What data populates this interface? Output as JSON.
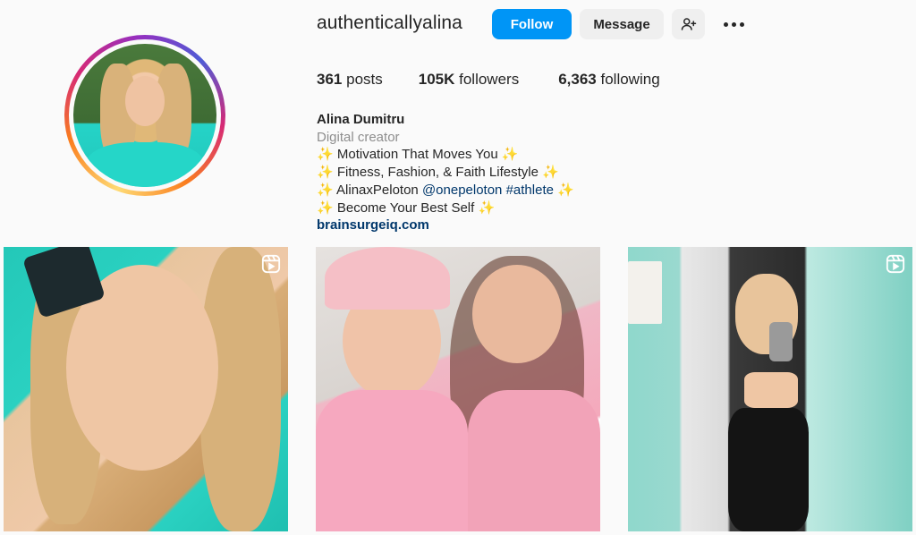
{
  "profile": {
    "username": "authenticallyalina",
    "follow_label": "Follow",
    "message_label": "Message",
    "add_user_icon": "person-add-icon",
    "more_icon": "more-options-icon"
  },
  "stats": {
    "posts_count": "361",
    "posts_label": "posts",
    "followers_count": "105K",
    "followers_label": "followers",
    "following_count": "6,363",
    "following_label": "following"
  },
  "bio": {
    "name": "Alina Dumitru",
    "category": "Digital creator",
    "sparkle": "✨",
    "line1": "Motivation That Moves You",
    "line2": "Fitness, Fashion, & Faith Lifestyle",
    "line3_prefix": "AlinaxPeloton",
    "line3_mention": "@onepeloton",
    "line3_hashtag": "#athlete",
    "line4": "Become Your Best Self",
    "link": "brainsurgeiq.com"
  },
  "posts": [
    {
      "type": "reel",
      "icon": "reels-icon"
    },
    {
      "type": "photo"
    },
    {
      "type": "reel",
      "icon": "reels-icon"
    }
  ],
  "colors": {
    "accent": "#0095f6",
    "secondary_button": "#efefef",
    "text": "#262626",
    "muted": "#8e8e8e",
    "link": "#00376b"
  }
}
